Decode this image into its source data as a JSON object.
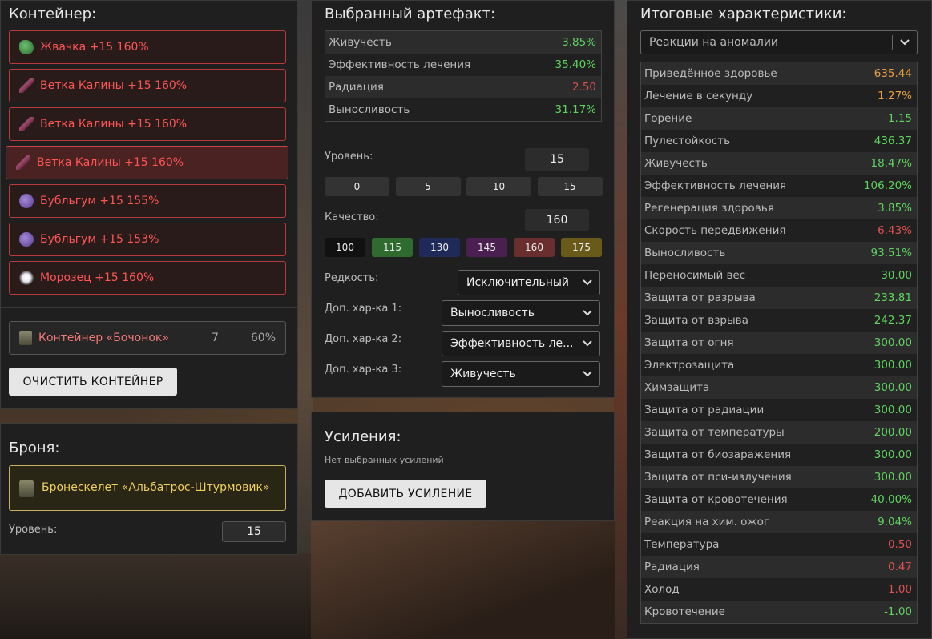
{
  "container": {
    "title": "Контейнер:",
    "items": [
      {
        "label": "Жвачка +15 160%",
        "icon": "gum-icon"
      },
      {
        "label": "Ветка Калины +15 160%",
        "icon": "branch-icon"
      },
      {
        "label": "Ветка Калины +15 160%",
        "icon": "branch-icon"
      },
      {
        "label": "Ветка Калины +15 160%",
        "icon": "branch-icon",
        "selected": true
      },
      {
        "label": "Бубльгум +15 155%",
        "icon": "bubblegum-icon"
      },
      {
        "label": "Бубльгум +15 153%",
        "icon": "bubblegum-icon"
      },
      {
        "label": "Морозец +15 160%",
        "icon": "frost-icon"
      }
    ],
    "box": {
      "name": "Контейнер «Бочонок»",
      "capacity": "7",
      "percent": "60%"
    },
    "clear_label": "ОЧИСТИТЬ КОНТЕЙНЕР"
  },
  "armor": {
    "title": "Броня:",
    "name": "Бронескелет «Альбатрос-Штурмовик»",
    "level_label": "Уровень:",
    "level_value": "15"
  },
  "artifact": {
    "title": "Выбранный артефакт:",
    "stats": [
      {
        "name": "Живучесть",
        "value": "3.85%",
        "color": "green"
      },
      {
        "name": "Эффективность лечения",
        "value": "35.40%",
        "color": "green"
      },
      {
        "name": "Радиация",
        "value": "2.50",
        "color": "red"
      },
      {
        "name": "Выносливость",
        "value": "31.17%",
        "color": "green"
      }
    ],
    "level_label": "Уровень:",
    "level_value": "15",
    "level_buttons": [
      "0",
      "5",
      "10",
      "15"
    ],
    "quality_label": "Качество:",
    "quality_value": "160",
    "quality_buttons": [
      {
        "label": "100",
        "color": "#111111"
      },
      {
        "label": "115",
        "color": "#2f6a2f"
      },
      {
        "label": "130",
        "color": "#1f2a5a"
      },
      {
        "label": "145",
        "color": "#4a2050"
      },
      {
        "label": "160",
        "color": "#6a2e2e"
      },
      {
        "label": "175",
        "color": "#6a5a1a"
      }
    ],
    "rarity_label": "Редкость:",
    "rarity_value": "Исключительный",
    "extra1_label": "Доп. хар-ка 1:",
    "extra1_value": "Выносливость",
    "extra2_label": "Доп. хар-ка 2:",
    "extra2_value": "Эффективность ле...",
    "extra3_label": "Доп. хар-ка 3:",
    "extra3_value": "Живучесть"
  },
  "boost": {
    "title": "Усиления:",
    "empty_text": "Нет выбранных усилений",
    "add_label": "ДОБАВИТЬ УСИЛЕНИЕ"
  },
  "totals": {
    "title": "Итоговые характеристики:",
    "filter_value": "Реакции на аномалии",
    "stats": [
      {
        "name": "Приведённое здоровье",
        "value": "635.44",
        "color": "orange"
      },
      {
        "name": "Лечение в секунду",
        "value": "1.27%",
        "color": "orange"
      },
      {
        "name": "Горение",
        "value": "-1.15",
        "color": "green"
      },
      {
        "name": "Пулестойкость",
        "value": "436.37",
        "color": "green"
      },
      {
        "name": "Живучесть",
        "value": "18.47%",
        "color": "green"
      },
      {
        "name": "Эффективность лечения",
        "value": "106.20%",
        "color": "green"
      },
      {
        "name": "Регенерация здоровья",
        "value": "3.85%",
        "color": "green"
      },
      {
        "name": "Скорость передвижения",
        "value": "-6.43%",
        "color": "red"
      },
      {
        "name": "Выносливость",
        "value": "93.51%",
        "color": "green"
      },
      {
        "name": "Переносимый вес",
        "value": "30.00",
        "color": "green"
      },
      {
        "name": "Защита от разрыва",
        "value": "233.81",
        "color": "green"
      },
      {
        "name": "Защита от взрыва",
        "value": "242.37",
        "color": "green"
      },
      {
        "name": "Защита от огня",
        "value": "300.00",
        "color": "green"
      },
      {
        "name": "Электрозащита",
        "value": "300.00",
        "color": "green"
      },
      {
        "name": "Химзащита",
        "value": "300.00",
        "color": "green"
      },
      {
        "name": "Защита от радиации",
        "value": "300.00",
        "color": "green"
      },
      {
        "name": "Защита от температуры",
        "value": "200.00",
        "color": "green"
      },
      {
        "name": "Защита от биозаражения",
        "value": "300.00",
        "color": "green"
      },
      {
        "name": "Защита от пси-излучения",
        "value": "300.00",
        "color": "green"
      },
      {
        "name": "Защита от кровотечения",
        "value": "40.00%",
        "color": "green"
      },
      {
        "name": "Реакция на хим. ожог",
        "value": "9.04%",
        "color": "green"
      },
      {
        "name": "Температура",
        "value": "0.50",
        "color": "red"
      },
      {
        "name": "Радиация",
        "value": "0.47",
        "color": "red"
      },
      {
        "name": "Холод",
        "value": "1.00",
        "color": "red"
      },
      {
        "name": "Кровотечение",
        "value": "-1.00",
        "color": "green"
      }
    ]
  }
}
